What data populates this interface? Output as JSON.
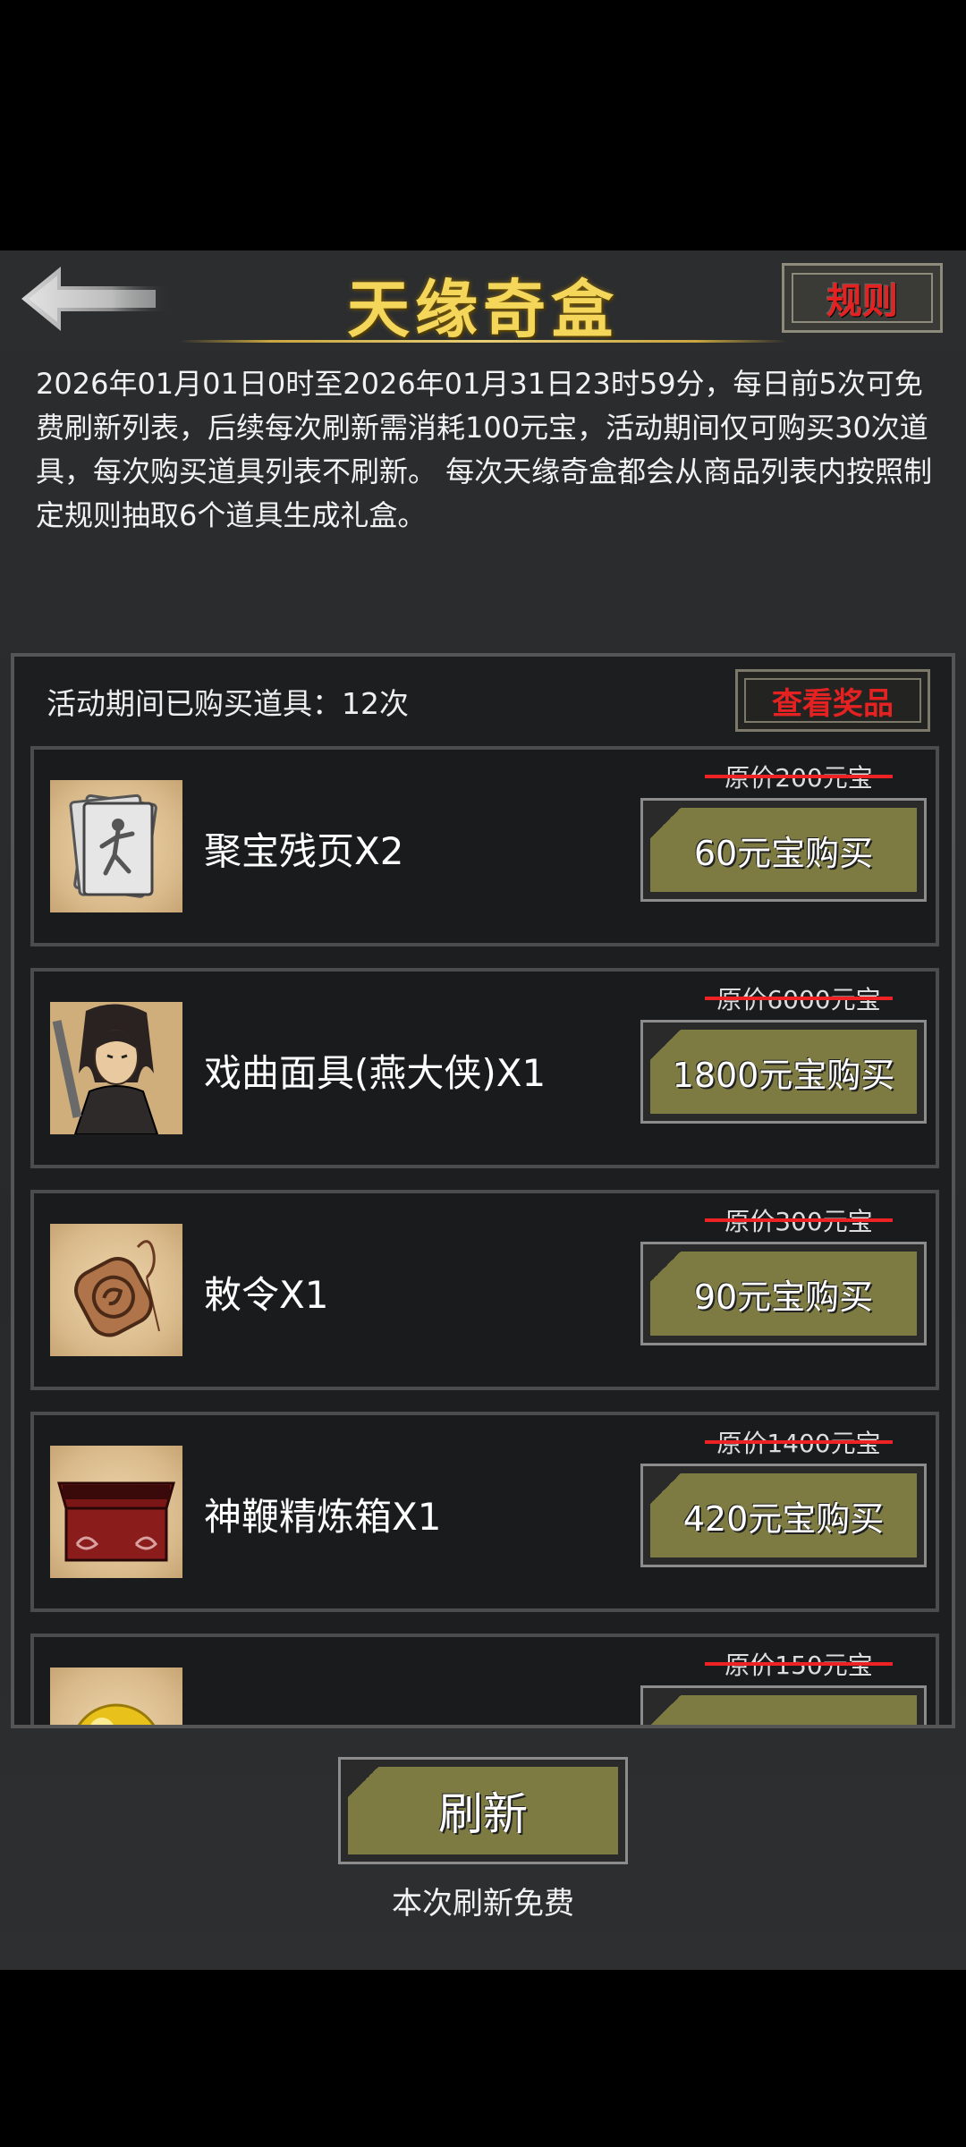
{
  "header": {
    "title": "天缘奇盒",
    "rule_label": "规则"
  },
  "description": "2026年01月01日0时至2026年01月31日23时59分，每日前5次可免费刷新列表，后续每次刷新需消耗100元宝，活动期间仅可购买30次道具，每次购买道具列表不刷新。 每次天缘奇盒都会从商品列表内按照制定规则抽取6个道具生成礼盒。",
  "panel": {
    "bought_text": "活动期间已购买道具：12次",
    "view_prize_label": "查看奖品"
  },
  "items": [
    {
      "name": "聚宝残页X2",
      "original_price": "原价200元宝",
      "buy_label": "60元宝购买",
      "icon": "scroll-pages-icon"
    },
    {
      "name": "戏曲面具(燕大侠)X1",
      "original_price": "原价6000元宝",
      "buy_label": "1800元宝购买",
      "icon": "hero-portrait-icon"
    },
    {
      "name": "敕令X1",
      "original_price": "原价300元宝",
      "buy_label": "90元宝购买",
      "icon": "token-icon"
    },
    {
      "name": "神鞭精炼箱X1",
      "original_price": "原价1400元宝",
      "buy_label": "420元宝购买",
      "icon": "chest-icon"
    },
    {
      "name": "",
      "original_price": "原价150元宝",
      "buy_label": "",
      "icon": "gold-orb-icon"
    }
  ],
  "refresh": {
    "label": "刷新",
    "note": "本次刷新免费"
  },
  "colors": {
    "title_gold": "#f4d65a",
    "button_olive": "#7d7b41",
    "accent_red": "#e52222"
  }
}
